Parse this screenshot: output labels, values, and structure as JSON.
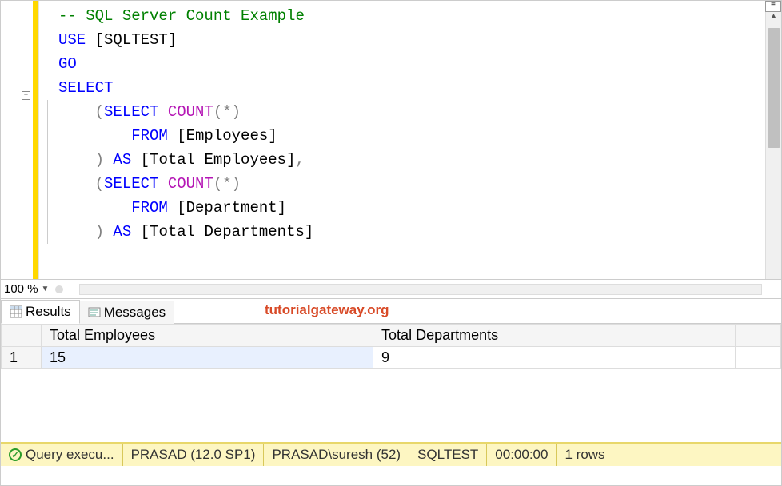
{
  "code": {
    "l1_comment": "-- SQL Server Count Example",
    "l2_use": "USE",
    "l2_db": " [SQLTEST]",
    "l3_go": "GO",
    "l4_select": "SELECT",
    "l5_open": "(",
    "l5_select": "SELECT",
    "l5_sp": " ",
    "l5_count": "COUNT",
    "l5_args": "(*)",
    "l6_from": "FROM",
    "l6_tbl": " [Employees]",
    "l7_close": ") ",
    "l7_as": "AS",
    "l7_alias": " [Total Employees]",
    "l7_comma": ",",
    "l8_open": "(",
    "l8_select": "SELECT",
    "l8_sp": " ",
    "l8_count": "COUNT",
    "l8_args": "(*)",
    "l9_from": "FROM",
    "l9_tbl": " [Department]",
    "l10_close": ") ",
    "l10_as": "AS",
    "l10_alias": " [Total Departments]"
  },
  "zoom": "100 %",
  "tabs": {
    "results": "Results",
    "messages": "Messages"
  },
  "watermark": "tutorialgateway.org",
  "grid": {
    "col1": "Total Employees",
    "col2": "Total Departments",
    "row1_num": "1",
    "row1_c1": "15",
    "row1_c2": "9"
  },
  "status": {
    "exec": "Query execu...",
    "server": "PRASAD (12.0 SP1)",
    "user": "PRASAD\\suresh (52)",
    "db": "SQLTEST",
    "time": "00:00:00",
    "rows": "1 rows"
  }
}
